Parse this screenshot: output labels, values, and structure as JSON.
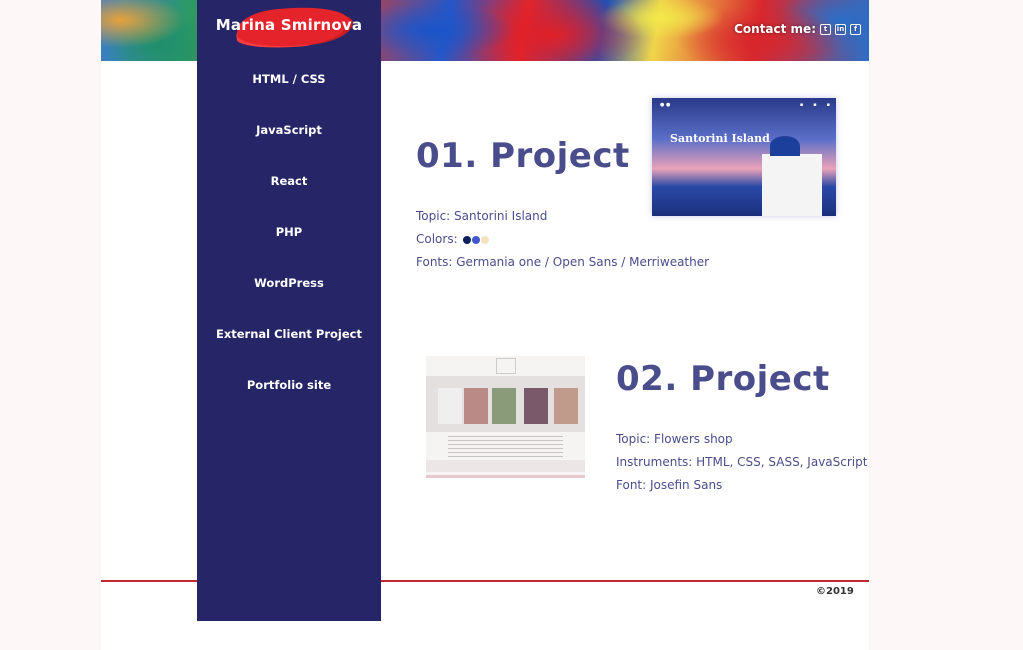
{
  "header": {
    "contact_label": "Contact me:",
    "social_icons": [
      "twitter-icon",
      "linkedin-icon",
      "facebook-icon"
    ]
  },
  "sidebar": {
    "brand": "Marina Smirnova",
    "items": [
      {
        "label": "HTML / CSS"
      },
      {
        "label": "JavaScript"
      },
      {
        "label": "React"
      },
      {
        "label": "PHP"
      },
      {
        "label": "WordPress"
      },
      {
        "label": "External Client Project"
      },
      {
        "label": "Portfolio site"
      }
    ]
  },
  "projects": [
    {
      "title": "01. Project",
      "topic": "Topic: Santorini Island",
      "colors_label": "Colors:",
      "colors": [
        "#0d1f5c",
        "#3f57c9",
        "#f3e3c0"
      ],
      "fonts": "Fonts: Germania one / Open Sans / Merriweather",
      "thumb_title": "Santorini Island"
    },
    {
      "title": "02. Project",
      "topic": "Topic: Flowers shop",
      "instruments": "Instruments: HTML, CSS, SASS, JavaScript",
      "font": "Font: Josefin Sans"
    }
  ],
  "footer": {
    "copyright": "©2019"
  },
  "colors": {
    "sidebar_bg": "#252567",
    "accent": "#c0282d",
    "text": "#4a4d8c"
  }
}
